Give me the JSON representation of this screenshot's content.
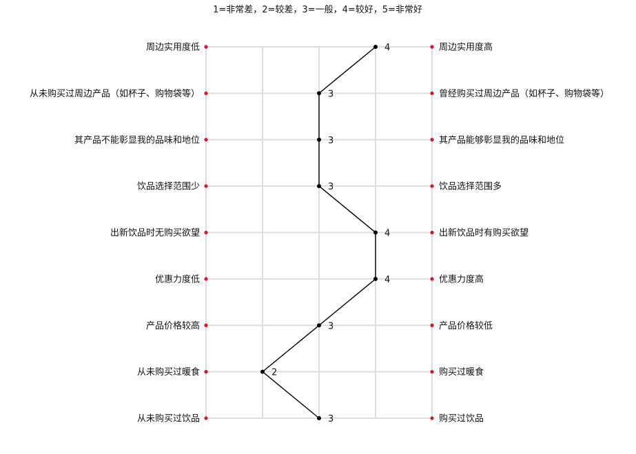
{
  "chart_data": {
    "type": "line",
    "title": "1=非常差，2=较差，3=一般，4=较好，5=非常好",
    "xlim": [
      1,
      5
    ],
    "left_labels": [
      "周边实用度低",
      "从未购买过周边产品（如杯子、购物袋等）",
      "其产品不能彰显我的品味和地位",
      "饮品选择范围少",
      "出新饮品时无购买欲望",
      "优惠力度低",
      "产品价格较高",
      "从未购买过暖食",
      "从未购买过饮品"
    ],
    "right_labels": [
      "周边实用度高",
      "曾经购买过周边产品（如杯子、购物袋等）",
      "其产品能够彰显我的品味和地位",
      "饮品选择范围多",
      "出新饮品时有购买欲望",
      "优惠力度高",
      "产品价格较低",
      "购买过暖食",
      "购买过饮品"
    ],
    "values": [
      4,
      3,
      3,
      3,
      4,
      4,
      3,
      2,
      3
    ],
    "value_labels": [
      "4",
      "3",
      "3",
      "3",
      "4",
      "4",
      "3",
      "2",
      "3"
    ],
    "grid": true,
    "colors": {
      "line": "#000000",
      "point": "#000000",
      "end_marker": "#e0141e",
      "grid": "#dddddd"
    }
  }
}
